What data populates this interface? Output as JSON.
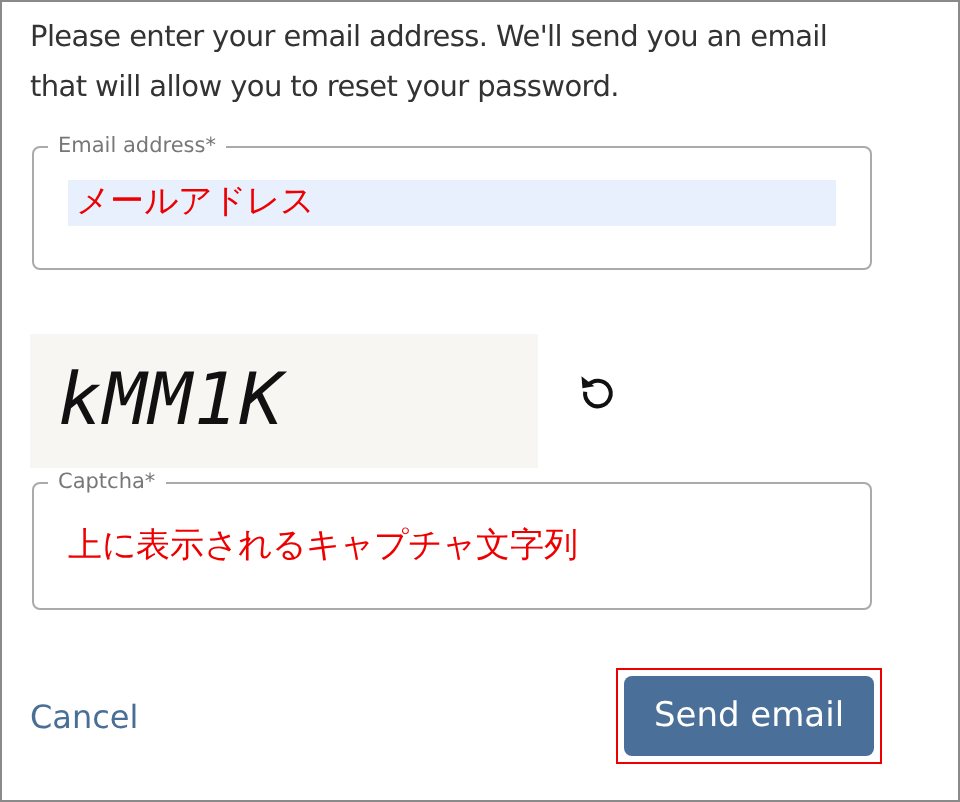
{
  "intro": "Please enter your email address. We'll send you an email that will allow you to reset your password.",
  "fields": [
    {
      "kind": "email",
      "label": "Email address*",
      "value": "メールアドレス",
      "autofilled": true
    },
    {
      "kind": "captcha",
      "label": "Captcha*",
      "value": "上に表示されるキャプチャ文字列",
      "autofilled": false
    }
  ],
  "captcha": {
    "text": "kMM1K"
  },
  "cancel": "Cancel",
  "submit": {
    "label": "Send email",
    "highlighted": true
  }
}
